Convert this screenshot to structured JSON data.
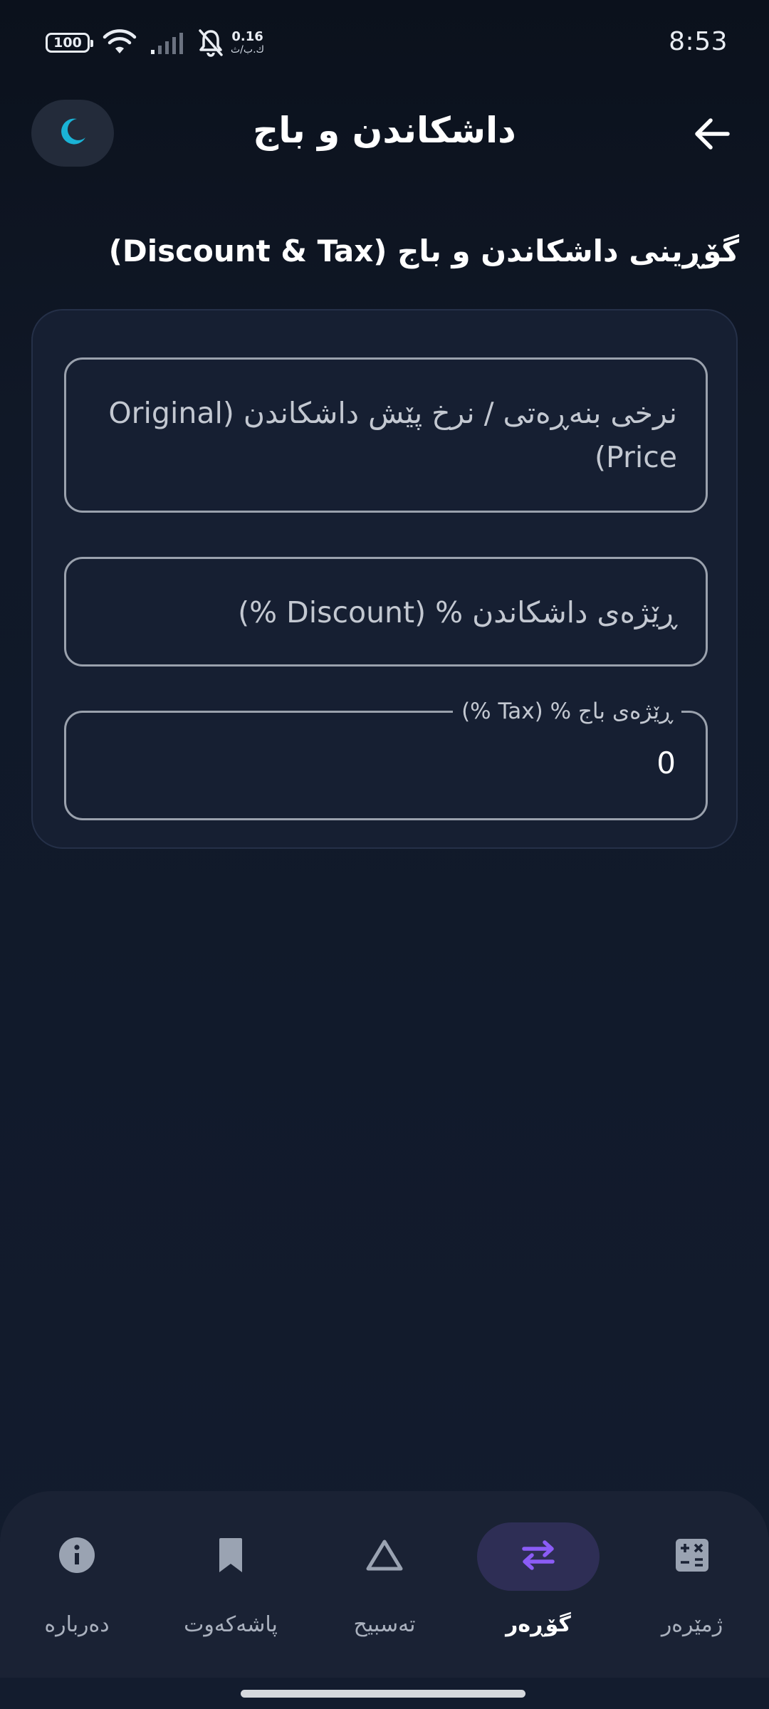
{
  "status_bar": {
    "battery": "100",
    "net_speed_value": "0.16",
    "net_speed_unit": "ك.ب/ث",
    "time": "8:53"
  },
  "app_bar": {
    "title": "داشکاندن و باج",
    "theme_icon": "moon-icon",
    "back_icon": "arrow-back-icon"
  },
  "section_title": "گۆڕینی داشکاندن و باج (Discount & Tax)",
  "form": {
    "original_price_placeholder": "نرخی بنەڕەتی / نرخ پێش داشکاندن (Original Price)",
    "discount_placeholder": "ڕێژەی داشکاندن % (Discount %)",
    "tax_label": "ڕێژەی باج % (Tax %)",
    "tax_value": "0"
  },
  "bottom_nav": {
    "items": [
      {
        "label": "دەربارە",
        "icon": "info-icon",
        "active": false
      },
      {
        "label": "پاشەکەوت",
        "icon": "bookmark-icon",
        "active": false
      },
      {
        "label": "تەسبیح",
        "icon": "triangle-icon",
        "active": false
      },
      {
        "label": "گۆڕەر",
        "icon": "swap-arrows-icon",
        "active": true
      },
      {
        "label": "ژمێرەر",
        "icon": "calculator-icon",
        "active": false
      }
    ]
  },
  "colors": {
    "background": "#101828",
    "card": "#161f32",
    "accent": "#8b5cf6",
    "theme_icon": "#1ab3d6",
    "active_pill": "#2e2e55"
  }
}
